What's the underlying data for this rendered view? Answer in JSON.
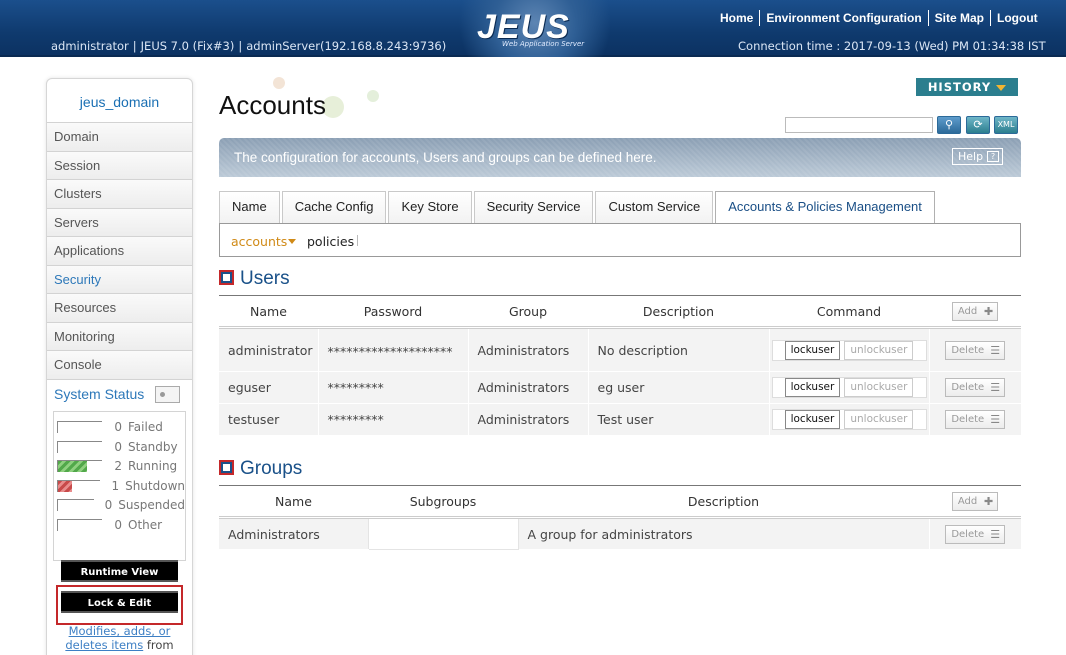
{
  "header": {
    "logo": "JEUS",
    "logo_sub": "Web Application Server",
    "nav": [
      "Home",
      "Environment Configuration",
      "Site Map",
      "Logout"
    ],
    "user": "administrator",
    "version": "JEUS 7.0 (Fix#3)",
    "server": "adminServer(192.168.8.243:9736)",
    "connection_time": "Connection time : 2017-09-13 (Wed) PM 01:34:38 IST"
  },
  "sidebar": {
    "domain": "jeus_domain",
    "items": [
      "Domain",
      "Session",
      "Clusters",
      "Servers",
      "Applications",
      "Security",
      "Resources",
      "Monitoring",
      "Console"
    ],
    "active_item": "Security",
    "system_status_label": "System Status",
    "status": [
      {
        "count": "0",
        "label": "Failed",
        "fill": 0
      },
      {
        "count": "0",
        "label": "Standby",
        "fill": 0
      },
      {
        "count": "2",
        "label": "Running",
        "fill": 0.67
      },
      {
        "count": "1",
        "label": "Shutdown",
        "fill": 0.33
      },
      {
        "count": "0",
        "label": "Suspended",
        "fill": 0
      },
      {
        "count": "0",
        "label": "Other",
        "fill": 0
      }
    ],
    "runtime_view": "Runtime View",
    "lock_edit": "Lock & Edit",
    "note_link": "Modifies, adds, or deletes items",
    "note_rest": " from"
  },
  "main": {
    "title": "Accounts",
    "history": "HISTORY",
    "banner": "The configuration for accounts, Users and groups can be defined here.",
    "help": "Help",
    "tabs": [
      "Name",
      "Cache Config",
      "Key Store",
      "Security Service",
      "Custom Service",
      "Accounts & Policies Management"
    ],
    "active_tab": "Accounts & Policies Management",
    "subtabs": {
      "accounts": "accounts",
      "policies": "policies"
    }
  },
  "users": {
    "title": "Users",
    "headers": [
      "Name",
      "Password",
      "Group",
      "Description",
      "Command"
    ],
    "add_label": "Add",
    "rows": [
      {
        "name": "administrator",
        "password": "********************",
        "group": "Administrators",
        "description": "No description"
      },
      {
        "name": "eguser",
        "password": "*********",
        "group": "Administrators",
        "description": "eg user"
      },
      {
        "name": "testuser",
        "password": "*********",
        "group": "Administrators",
        "description": "Test user"
      }
    ],
    "lock_label": "lockuser",
    "unlock_label": "unlockuser",
    "delete_label": "Delete"
  },
  "groups": {
    "title": "Groups",
    "headers": [
      "Name",
      "Subgroups",
      "Description"
    ],
    "add_label": "Add",
    "rows": [
      {
        "name": "Administrators",
        "subgroups": "",
        "description": "A group for administrators"
      }
    ],
    "delete_label": "Delete"
  }
}
